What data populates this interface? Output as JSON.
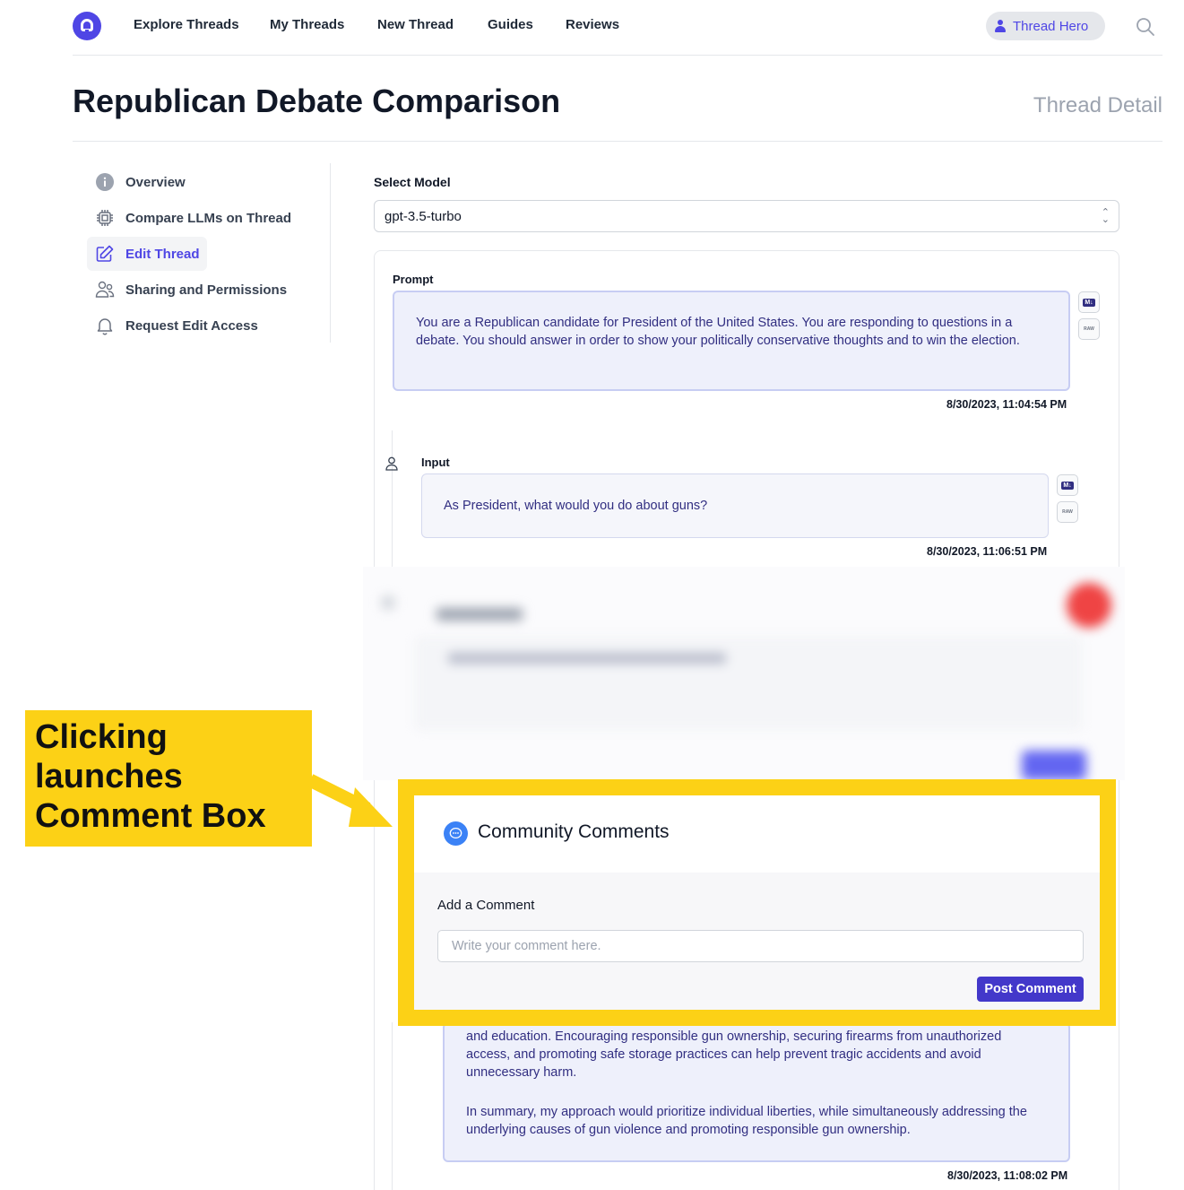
{
  "nav": {
    "links": [
      "Explore Threads",
      "My Threads",
      "New Thread",
      "Guides",
      "Reviews"
    ],
    "user_label": "Thread Hero",
    "icons": {
      "logo": "app-logo",
      "user": "user-icon",
      "search": "search-icon"
    }
  },
  "header": {
    "title": "Republican Debate Comparison",
    "subtitle": "Thread Detail"
  },
  "sidebar": {
    "items": [
      {
        "label": "Overview",
        "icon": "info-icon",
        "active": false
      },
      {
        "label": "Compare LLMs on Thread",
        "icon": "chip-icon",
        "active": false
      },
      {
        "label": "Edit Thread",
        "icon": "edit-icon",
        "active": true
      },
      {
        "label": "Sharing and Permissions",
        "icon": "users-icon",
        "active": false
      },
      {
        "label": "Request Edit Access",
        "icon": "bell-icon",
        "active": false
      }
    ]
  },
  "model": {
    "label": "Select Model",
    "value": "gpt-3.5-turbo"
  },
  "prompt": {
    "label": "Prompt",
    "text": "You are a Republican candidate for President of the United States. You are responding to questions in a debate. You should answer in order to show your politically conservative thoughts and to win the election.",
    "timestamp": "8/30/2023, 11:04:54 PM",
    "md_label": "M↓",
    "raw_label": "RAW"
  },
  "input": {
    "label": "Input",
    "text": "As President, what would you do about guns?",
    "timestamp": "8/30/2023, 11:06:51 PM",
    "md_label": "M↓",
    "raw_label": "RAW"
  },
  "response": {
    "paragraph_1": "and education. Encouraging responsible gun ownership, securing firearms from unauthorized access, and promoting safe storage practices can help prevent tragic accidents and avoid unnecessary harm.",
    "paragraph_2": "In summary, my approach would prioritize individual liberties, while simultaneously addressing the underlying causes of gun violence and promoting responsible gun ownership.",
    "timestamp": "8/30/2023, 11:08:02 PM"
  },
  "callout": {
    "text": "Clicking launches Comment Box",
    "color": "#fcd116"
  },
  "comments": {
    "title": "Community Comments",
    "add_label": "Add a Comment",
    "placeholder": "Write your comment here.",
    "post_label": "Post Comment"
  },
  "colors": {
    "accent": "#4f46e5",
    "bubble_bg": "#eef0fb",
    "highlight": "#fcd116"
  }
}
